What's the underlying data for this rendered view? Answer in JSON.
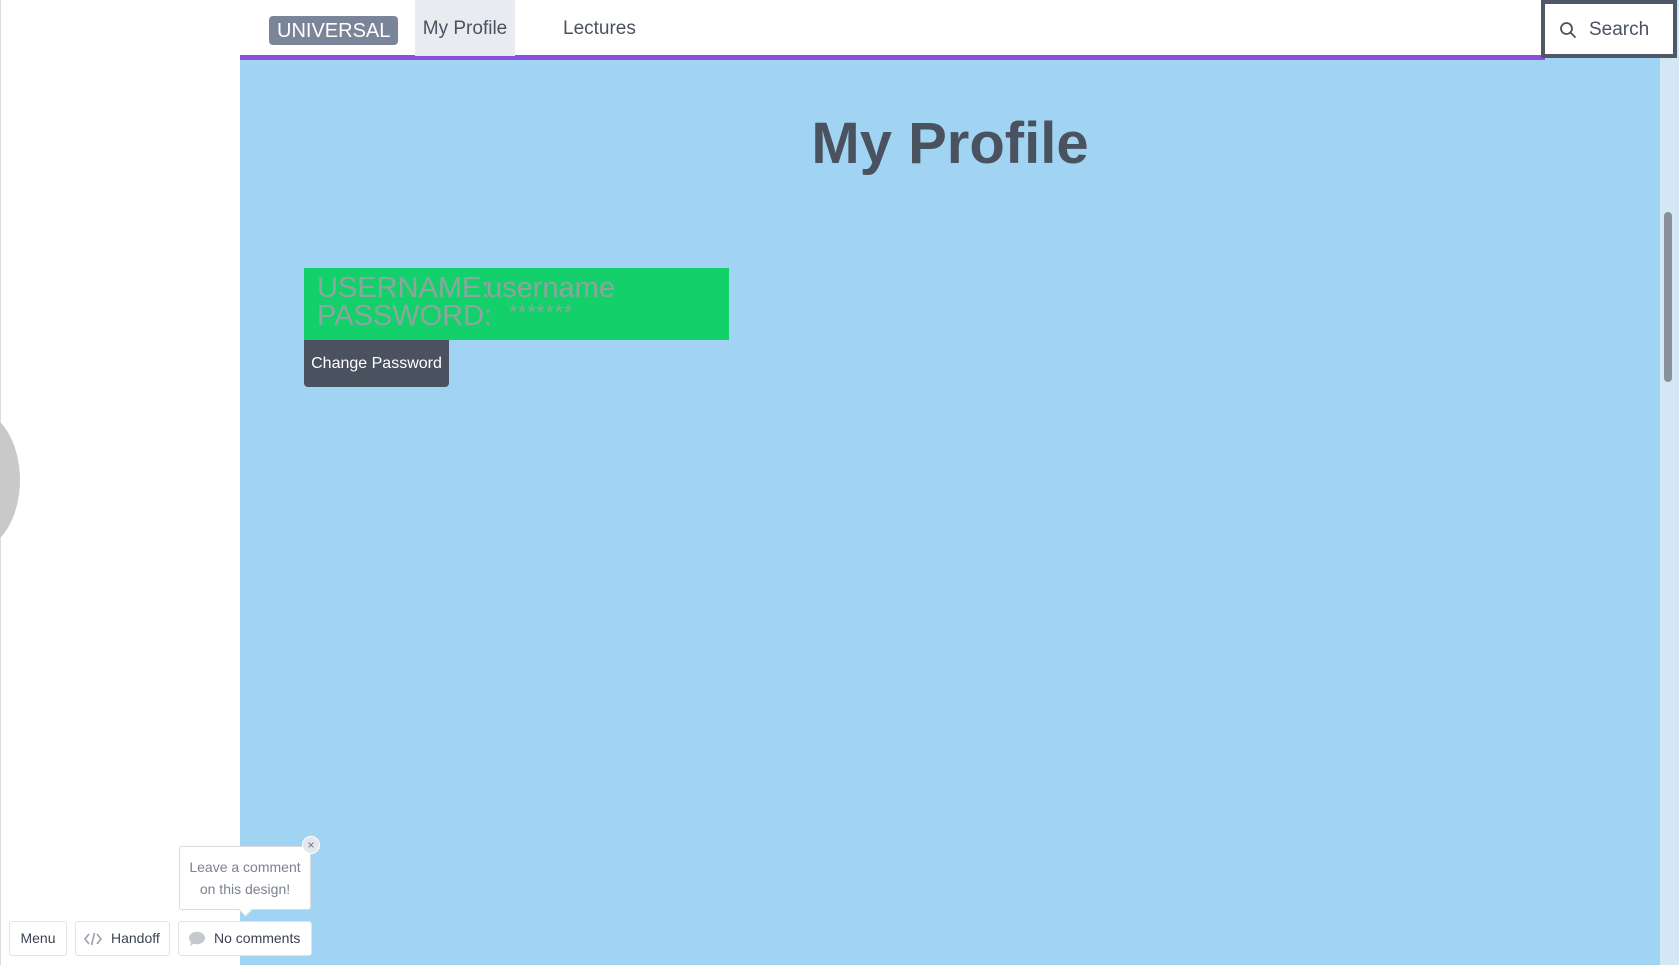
{
  "nav": {
    "brand": "UNIVERSAL",
    "tabs": [
      {
        "label": "My Profile",
        "active": true
      },
      {
        "label": "Lectures",
        "active": false
      }
    ],
    "search_label": "Search",
    "accent_color": "#8a4fe0"
  },
  "main": {
    "title": "My Profile",
    "credentials": {
      "username_label": "USERNAME:",
      "username_value": "username",
      "password_label": "PASSWORD:",
      "password_value": "*******"
    },
    "change_password_label": "Change Password"
  },
  "comment_tip": {
    "line1": "Leave a comment",
    "line2": "on this design!",
    "close": "×"
  },
  "toolbar": {
    "menu_label": "Menu",
    "handoff_label": "Handoff",
    "comments_label": "No comments"
  },
  "colors": {
    "artboard_bg": "#a1d3f2",
    "credentials_bg": "#14d06a",
    "dark": "#4a5260"
  },
  "icons": {
    "search": "magnifier",
    "handoff": "code-brackets",
    "comments": "speech-bubble"
  }
}
